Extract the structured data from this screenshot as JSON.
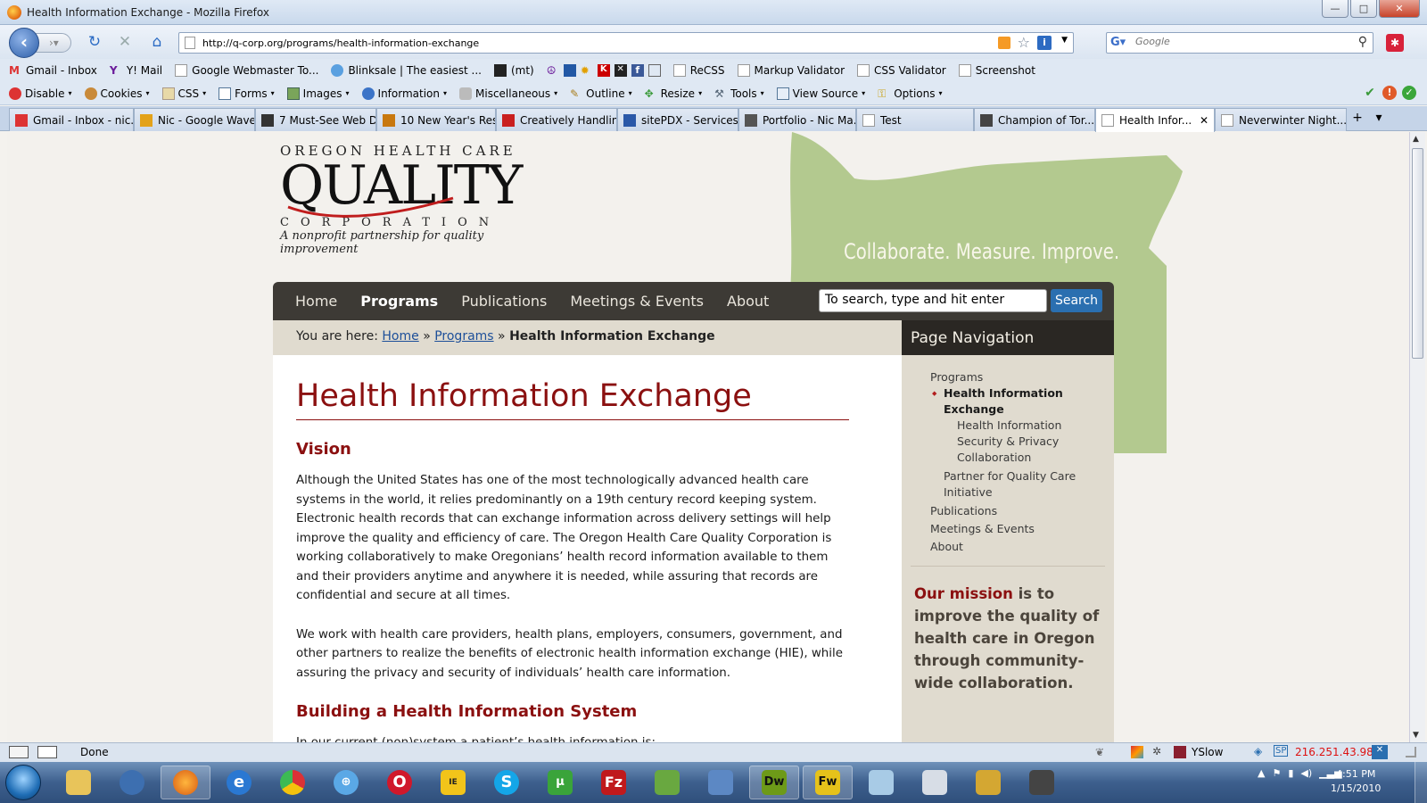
{
  "window": {
    "title": "Health Information Exchange - Mozilla Firefox",
    "min": "—",
    "max": "□",
    "close": "✕"
  },
  "nav": {
    "url": "http://q-corp.org/programs/health-information-exchange",
    "search_placeholder": "Google"
  },
  "bookmarks": [
    "Gmail - Inbox",
    "Y! Mail",
    "Google Webmaster To...",
    "Blinksale | The easiest ...",
    "(mt)",
    "ReCSS",
    "Markup Validator",
    "CSS Validator",
    "Screenshot"
  ],
  "devtoolbar": [
    "Disable",
    "Cookies",
    "CSS",
    "Forms",
    "Images",
    "Information",
    "Miscellaneous",
    "Outline",
    "Resize",
    "Tools",
    "View Source",
    "Options"
  ],
  "tabs": [
    {
      "label": "Gmail - Inbox - nic...",
      "icon": "gmail-icon",
      "color": "#d33"
    },
    {
      "label": "Nic - Google Wave",
      "icon": "wave-icon",
      "color": "#e3a21a"
    },
    {
      "label": "7 Must-See Web D...",
      "icon": "site-icon",
      "color": "#333"
    },
    {
      "label": "10 New Year's Res...",
      "icon": "site-icon",
      "color": "#c8780f"
    },
    {
      "label": "Creatively Handlin...",
      "icon": "site-icon",
      "color": "#c91f1f"
    },
    {
      "label": "sitePDX - Services ...",
      "icon": "site-icon",
      "color": "#2a58a8"
    },
    {
      "label": "Portfolio - Nic Ma...",
      "icon": "site-icon",
      "color": "#555"
    },
    {
      "label": "Test",
      "icon": "page-icon",
      "color": "#fff"
    },
    {
      "label": "Champion of Tor...",
      "icon": "site-icon",
      "color": "#444"
    },
    {
      "label": "Health Infor...",
      "icon": "page-icon",
      "color": "#fff",
      "active": true,
      "close": "✕"
    },
    {
      "label": "Neverwinter Night...",
      "icon": "page-icon",
      "color": "#fff"
    }
  ],
  "page": {
    "logo": {
      "top": "OREGON HEALTH CARE",
      "main": "QUALITY",
      "corp": "CORPORATION",
      "tagline": "A nonprofit partnership for quality improvement"
    },
    "slogan": "Collaborate. Measure. Improve.",
    "menu": [
      "Home",
      "Programs",
      "Publications",
      "Meetings & Events",
      "About"
    ],
    "search_value": "To search, type and hit enter",
    "search_button": "Search",
    "breadcrumb": {
      "prefix": "You are here:",
      "home": "Home",
      "programs": "Programs",
      "sep": "»",
      "current": "Health Information Exchange"
    },
    "title": "Health Information Exchange",
    "vision_heading": "Vision",
    "p1": "Although the United States has one of the most technologically advanced health care systems in the world, it relies predominantly on a 19th century record keeping system. Electronic health records that can exchange information across delivery settings will help improve the quality and efficiency of care. The Oregon Health Care Quality Corporation is working collaboratively to make Oregonians’ health record information available to them and their providers anytime and anywhere it is needed, while assuring that records are confidential and secure at all times.",
    "p2": "We work with health care providers, health plans, employers, consumers, government, and other partners to realize the benefits of electronic health information exchange (HIE), while assuring the privacy and security of individuals’ health care information.",
    "section2_heading": "Building a Health Information System",
    "p3_partial": "In our current (non)system a patient’s health information is:",
    "pagenav": {
      "heading": "Page Navigation",
      "programs": "Programs",
      "hie": "Health Information Exchange",
      "sub1": "Health Information",
      "sub2": "Security & Privacy",
      "sub3": "Collaboration",
      "partner": "Partner for Quality Care Initiative",
      "publications": "Publications",
      "meetings": "Meetings & Events",
      "about": "About"
    },
    "mission": {
      "lead": "Our mission",
      "rest": " is to improve the quality of health care in Oregon through community-wide collaboration."
    }
  },
  "status": {
    "text": "Done",
    "yslow": "YSlow",
    "ip": "216.251.43.98"
  },
  "taskbar": {
    "time": "4:51 PM",
    "date": "1/15/2010"
  }
}
